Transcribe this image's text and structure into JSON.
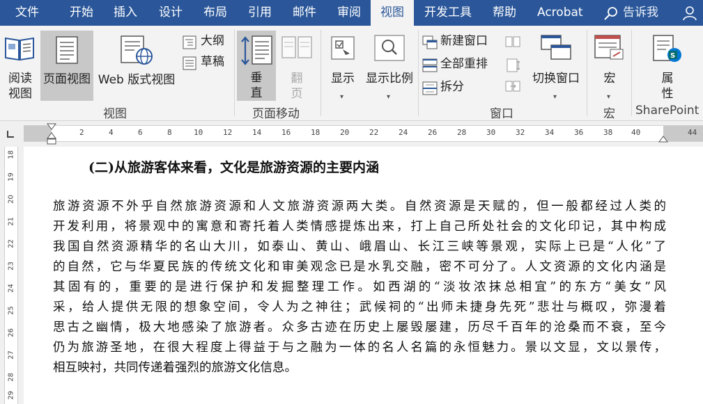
{
  "tabs": [
    {
      "label": "文件",
      "active": false
    },
    {
      "label": "开始",
      "active": false
    },
    {
      "label": "插入",
      "active": false
    },
    {
      "label": "设计",
      "active": false
    },
    {
      "label": "布局",
      "active": false
    },
    {
      "label": "引用",
      "active": false
    },
    {
      "label": "邮件",
      "active": false
    },
    {
      "label": "审阅",
      "active": false
    },
    {
      "label": "视图",
      "active": true
    },
    {
      "label": "开发工具",
      "active": false
    },
    {
      "label": "帮助",
      "active": false
    },
    {
      "label": "Acrobat",
      "active": false
    }
  ],
  "tell_me": {
    "label": "告诉我",
    "icon": "lightbulb-search-icon"
  },
  "colors": {
    "tabbar": "#2b579a",
    "ribbon": "#f3f3f3",
    "pressed": "#c8c8c8",
    "accent": "#2b579a"
  },
  "ribbon": {
    "views": {
      "read_mode": {
        "line1": "阅读",
        "line2": "视图"
      },
      "print_layout": "页面视图",
      "web_layout": "Web 版式视图",
      "outline": "大纲",
      "draft": "草稿",
      "group_label": "视图"
    },
    "page_movement": {
      "vertical": {
        "line1": "垂",
        "line2": "直"
      },
      "side_to_side": {
        "line1": "翻",
        "line2": "页"
      },
      "group_label": "页面移动"
    },
    "show": "显示",
    "zoom": "显示比例",
    "window": {
      "new_window": "新建窗口",
      "arrange_all": "全部重排",
      "split": "拆分",
      "switch_windows": "切换窗口",
      "group_label": "窗口"
    },
    "macros": {
      "label": "宏",
      "group_label": "宏"
    },
    "sharepoint": {
      "line1": "属",
      "line2": "性",
      "group_label": "SharePoint"
    }
  },
  "ruler": {
    "h_numbers": [
      "2",
      "4",
      "6",
      "8",
      "10",
      "12",
      "14",
      "16",
      "18",
      "20",
      "22",
      "24",
      "26",
      "28",
      "30",
      "32",
      "34",
      "36",
      "38",
      "40",
      "44"
    ],
    "v_numbers": [
      "18",
      "19",
      "20",
      "21",
      "22",
      "23",
      "24",
      "25",
      "26",
      "27",
      "28",
      "29"
    ]
  },
  "document": {
    "heading": "(二)从旅游客体来看，文化是旅游资源的主要内涵",
    "lines": [
      "旅游资源不外乎自然旅游资源和人文旅游资源两大类。自然资源是天赋的，但一般都经过人类的",
      "开发利用，将景观中的寓意和寄托着人类情感提炼出来，打上自己所处社会的文化印记，其中构成",
      "我国自然资源精华的名山大川，如泰山、黄山、峨眉山、长江三峡等景观，实际上已是“人化”了",
      "的自然，它与华夏民族的传统文化和审美观念已是水乳交融，密不可分了。人文资源的文化内涵是",
      "其固有的，重要的是进行保护和发掘整理工作。如西湖的“淡妆浓抹总相宜”的东方“美女”风",
      "采，给人提供无限的想象空间，令人为之神往；武候祠的“出师未捷身先死”悲壮与概叹，弥漫着",
      "思古之幽情，极大地感染了旅游者。众多古迹在历史上屡毁屡建，历尽千百年的沧桑而不衰，至今",
      "仍为旅游圣地，在很大程度上得益于与之融为一体的名人名篇的永恒魅力。景以文显，文以景传，",
      "相互映衬，共同传递着强烈的旅游文化信息。"
    ]
  }
}
